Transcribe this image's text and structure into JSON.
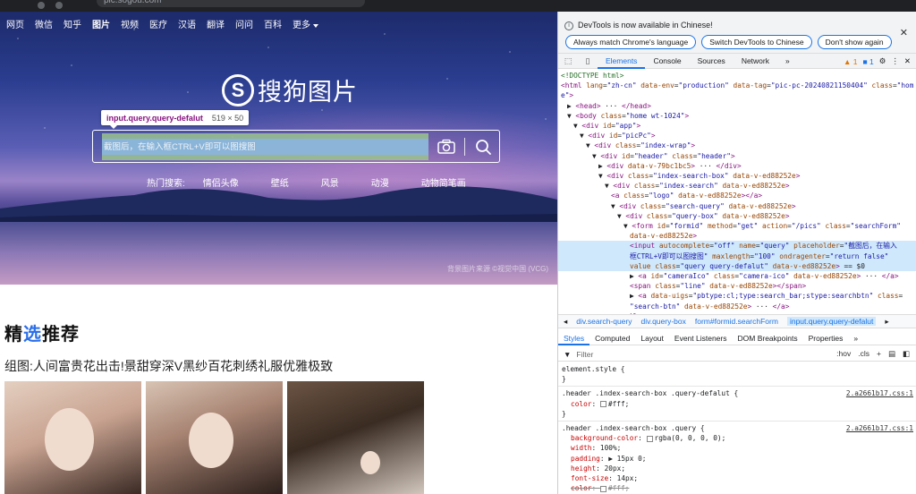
{
  "browser": {
    "url": "pic.sogou.com"
  },
  "nav": {
    "items": [
      "网页",
      "微信",
      "知乎",
      "图片",
      "视频",
      "医疗",
      "汉语",
      "翻译",
      "问问",
      "百科"
    ],
    "more": "更多"
  },
  "logo": {
    "mark": "S",
    "text": "搜狗图片"
  },
  "tooltip": {
    "selector": "input.query.query-defalut",
    "size": "519 × 50"
  },
  "search": {
    "placeholder": "截图后，在输入框CTRL+V即可以图搜图"
  },
  "hot": {
    "label": "热门搜索:",
    "items": [
      "情侣头像",
      "壁纸",
      "风景",
      "动漫",
      "动物简笔画"
    ]
  },
  "credit": "背景图片来源 ©视觉中国 (VCG)",
  "featured": {
    "title_a": "精",
    "title_b": "选",
    "title_c": "推荐"
  },
  "album": {
    "title": "组图:人间富贵花出击!景甜穿深V黑纱百花刺绣礼服优雅极致"
  },
  "devtools": {
    "banner": {
      "message": "DevTools is now available in Chinese!",
      "buttons": [
        "Always match Chrome's language",
        "Switch DevTools to Chinese",
        "Don't show again"
      ]
    },
    "tabs": [
      "Elements",
      "Console",
      "Sources",
      "Network"
    ],
    "more_tabs": "»",
    "warnings": "1",
    "messages": "1",
    "dom_lines": [
      {
        "indent": 0,
        "html": "<span class=\"cmt\">&lt;!DOCTYPE html&gt;</span>"
      },
      {
        "indent": 0,
        "html": "<span class=\"tag\">&lt;html</span> <span class=\"attr\">lang</span>=<span class=\"val\">\"zh-cn\"</span> <span class=\"attr\">data-env</span>=<span class=\"val\">\"production\"</span> <span class=\"attr\">data-tag</span>=<span class=\"val\">\"pic-pc-20240821150404\"</span> <span class=\"attr\">class</span>=<span class=\"val\">\"hom</span>"
      },
      {
        "indent": 0,
        "html": "<span class=\"val\">e\"</span><span class=\"tag\">&gt;</span>"
      },
      {
        "indent": 1,
        "html": "▶ <span class=\"tag\">&lt;head&gt;</span> ··· <span class=\"tag\">&lt;/head&gt;</span>"
      },
      {
        "indent": 1,
        "html": "▼ <span class=\"tag\">&lt;body</span> <span class=\"attr\">class</span>=<span class=\"val\">\"home wt-1024\"</span><span class=\"tag\">&gt;</span>"
      },
      {
        "indent": 2,
        "html": "▼ <span class=\"tag\">&lt;div</span> <span class=\"attr\">id</span>=<span class=\"val\">\"app\"</span><span class=\"tag\">&gt;</span>"
      },
      {
        "indent": 3,
        "html": "▼ <span class=\"tag\">&lt;div</span> <span class=\"attr\">id</span>=<span class=\"val\">\"picPc\"</span><span class=\"tag\">&gt;</span>"
      },
      {
        "indent": 4,
        "html": "▼ <span class=\"tag\">&lt;div</span> <span class=\"attr\">class</span>=<span class=\"val\">\"index-wrap\"</span><span class=\"tag\">&gt;</span>"
      },
      {
        "indent": 5,
        "html": "▼ <span class=\"tag\">&lt;div</span> <span class=\"attr\">id</span>=<span class=\"val\">\"header\"</span> <span class=\"attr\">class</span>=<span class=\"val\">\"header\"</span><span class=\"tag\">&gt;</span>"
      },
      {
        "indent": 6,
        "html": "▶ <span class=\"tag\">&lt;div</span> <span class=\"attr\">data-v-79bc1bc5</span><span class=\"tag\">&gt;</span> ··· <span class=\"tag\">&lt;/div&gt;</span>"
      },
      {
        "indent": 6,
        "html": "▼ <span class=\"tag\">&lt;div</span> <span class=\"attr\">class</span>=<span class=\"val\">\"index-search-box\"</span> <span class=\"attr\">data-v-ed88252e</span><span class=\"tag\">&gt;</span>"
      },
      {
        "indent": 7,
        "html": "▼ <span class=\"tag\">&lt;div</span> <span class=\"attr\">class</span>=<span class=\"val\">\"index-search\"</span> <span class=\"attr\">data-v-ed88252e</span><span class=\"tag\">&gt;</span>"
      },
      {
        "indent": 8,
        "html": "<span class=\"tag\">&lt;a</span> <span class=\"attr\">class</span>=<span class=\"val\">\"logo\"</span> <span class=\"attr\">data-v-ed88252e</span><span class=\"tag\">&gt;&lt;/a&gt;</span>"
      },
      {
        "indent": 8,
        "html": "▼ <span class=\"tag\">&lt;div</span> <span class=\"attr\">class</span>=<span class=\"val\">\"search-query\"</span> <span class=\"attr\">data-v-ed88252e</span><span class=\"tag\">&gt;</span>"
      },
      {
        "indent": 9,
        "html": "▼ <span class=\"tag\">&lt;div</span> <span class=\"attr\">class</span>=<span class=\"val\">\"query-box\"</span> <span class=\"attr\">data-v-ed88252e</span><span class=\"tag\">&gt;</span>"
      },
      {
        "indent": 10,
        "html": "▼ <span class=\"tag\">&lt;form</span> <span class=\"attr\">id</span>=<span class=\"val\">\"formid\"</span> <span class=\"attr\">method</span>=<span class=\"val\">\"get\"</span> <span class=\"attr\">action</span>=<span class=\"val\">\"/pics\"</span> <span class=\"attr\">class</span>=<span class=\"val\">\"searchForm\"</span>"
      },
      {
        "indent": 11,
        "html": "<span class=\"attr\">data-v-ed88252e</span><span class=\"tag\">&gt;</span>"
      },
      {
        "indent": 11,
        "sel": true,
        "html": "<span class=\"tag\">&lt;input</span> <span class=\"attr\">autocomplete</span>=<span class=\"val\">\"off\"</span> <span class=\"attr\">name</span>=<span class=\"val\">\"query\"</span> <span class=\"attr\">placeholder</span>=<span class=\"val\">\"截图后，在输入</span>"
      },
      {
        "indent": 11,
        "sel": true,
        "html": "<span class=\"val\">框CTRL+V即可以图搜图\"</span> <span class=\"attr\">maxlength</span>=<span class=\"val\">\"100\"</span> <span class=\"attr\">ondragenter</span>=<span class=\"val\">\"return false\"</span>"
      },
      {
        "indent": 11,
        "sel": true,
        "html": "<span class=\"attr\">value</span> <span class=\"attr\">class</span>=<span class=\"val\">\"query query-defalut\"</span> <span class=\"attr\">data-v-ed88252e</span><span class=\"tag\">&gt;</span> == $0"
      },
      {
        "indent": 11,
        "html": "▶ <span class=\"tag\">&lt;a</span> <span class=\"attr\">id</span>=<span class=\"val\">\"cameraIco\"</span> <span class=\"attr\">class</span>=<span class=\"val\">\"camera-ico\"</span> <span class=\"attr\">data-v-ed88252e</span><span class=\"tag\">&gt;</span> ··· <span class=\"tag\">&lt;/a&gt;</span>"
      },
      {
        "indent": 11,
        "html": "<span class=\"tag\">&lt;span</span> <span class=\"attr\">class</span>=<span class=\"val\">\"line\"</span> <span class=\"attr\">data-v-ed88252e</span><span class=\"tag\">&gt;&lt;/span&gt;</span>"
      },
      {
        "indent": 11,
        "html": "▶ <span class=\"tag\">&lt;a</span> <span class=\"attr\">data-uigs</span>=<span class=\"val\">\"pbtype:cl;type:search_bar;stype:searchbtn\"</span> <span class=\"attr\">class</span>="
      },
      {
        "indent": 11,
        "html": "<span class=\"val\">\"search-btn\"</span> <span class=\"attr\">data-v-ed88252e</span><span class=\"tag\">&gt;</span> ··· <span class=\"tag\">&lt;/a&gt;</span>"
      },
      {
        "indent": 10,
        "html": "<span class=\"tag\">&lt;/form&gt;</span>"
      }
    ],
    "breadcrumbs": [
      "div.search-query",
      "div.query-box",
      "form#formid.searchForm",
      "input.query.query-defalut"
    ],
    "subtabs": [
      "Styles",
      "Computed",
      "Layout",
      "Event Listeners",
      "DOM Breakpoints",
      "Properties"
    ],
    "filter": {
      "placeholder": "Filter",
      "hov": ":hov",
      "cls": ".cls"
    },
    "style_rules": [
      {
        "selector": "element.style {",
        "src": "",
        "props": [],
        "end": "}"
      },
      {
        "selector": ".header .index-search-box .query-defalut {",
        "src": "2.a2661b17.css:1",
        "props": [
          {
            "name": "color",
            "value": "#fff;",
            "swatch": "#ffffff"
          }
        ],
        "end": "}"
      },
      {
        "selector": ".header .index-search-box .query {",
        "src": "2.a2661b17.css:1",
        "props": [
          {
            "name": "background-color",
            "value": "rgba(0, 0, 0, 0);",
            "swatch": "#ffffff"
          },
          {
            "name": "width",
            "value": "100%;"
          },
          {
            "name": "padding",
            "value": "▶ 15px 0;"
          },
          {
            "name": "height",
            "value": "20px;"
          },
          {
            "name": "font-size",
            "value": "14px;"
          },
          {
            "name": "color",
            "value": "#fff;",
            "struck": true,
            "swatch": "#ffffff"
          }
        ],
        "end": ""
      }
    ]
  }
}
